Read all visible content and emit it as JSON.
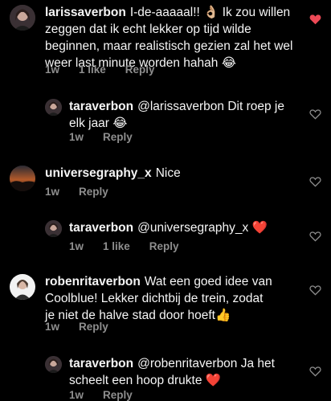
{
  "comments": [
    {
      "username": "larissaverbon",
      "text": "I-de-aaaaal!! 👌🏼 Ik zou willen zeggen dat ik echt lekker op tijd wilde beginnen, maar realistisch gezien zal het wel weer last minute worden hahah 😂",
      "time": "1w",
      "likes": "1 like",
      "reply": "Reply",
      "liked": true,
      "avatar_icon": "avatar-photo-icon"
    },
    {
      "username": "taraverbon",
      "text": "@larissaverbon Dit roep je elk jaar 😂",
      "time": "1w",
      "likes": "",
      "reply": "Reply",
      "liked": false,
      "avatar_icon": "avatar-photo-icon"
    },
    {
      "username": "universegraphy_x",
      "text": "Nice",
      "time": "1w",
      "likes": "",
      "reply": "Reply",
      "liked": false,
      "avatar_icon": "avatar-sunset-icon"
    },
    {
      "username": "taraverbon",
      "text": "@universegraphy_x ❤️",
      "time": "1w",
      "likes": "1 like",
      "reply": "Reply",
      "liked": false,
      "avatar_icon": "avatar-photo-icon"
    },
    {
      "username": "robenritaverbon",
      "text": "Wat een goed idee van Coolblue! Lekker dichtbij de trein, zodat je niet de halve stad door hoeft👍",
      "time": "1w",
      "likes": "",
      "reply": "Reply",
      "liked": false,
      "avatar_icon": "avatar-portrait-icon"
    },
    {
      "username": "taraverbon",
      "text": "@robenritaverbon Ja het scheelt een hoop drukte ❤️",
      "time": "1w",
      "likes": "",
      "reply": "Reply",
      "liked": false,
      "avatar_icon": "avatar-photo-icon"
    }
  ],
  "colors": {
    "background": "#000000",
    "text": "#f5f5f5",
    "meta": "#8e8e8e",
    "liked_heart": "#ed4956",
    "heart_outline": "#8e8e8e"
  }
}
